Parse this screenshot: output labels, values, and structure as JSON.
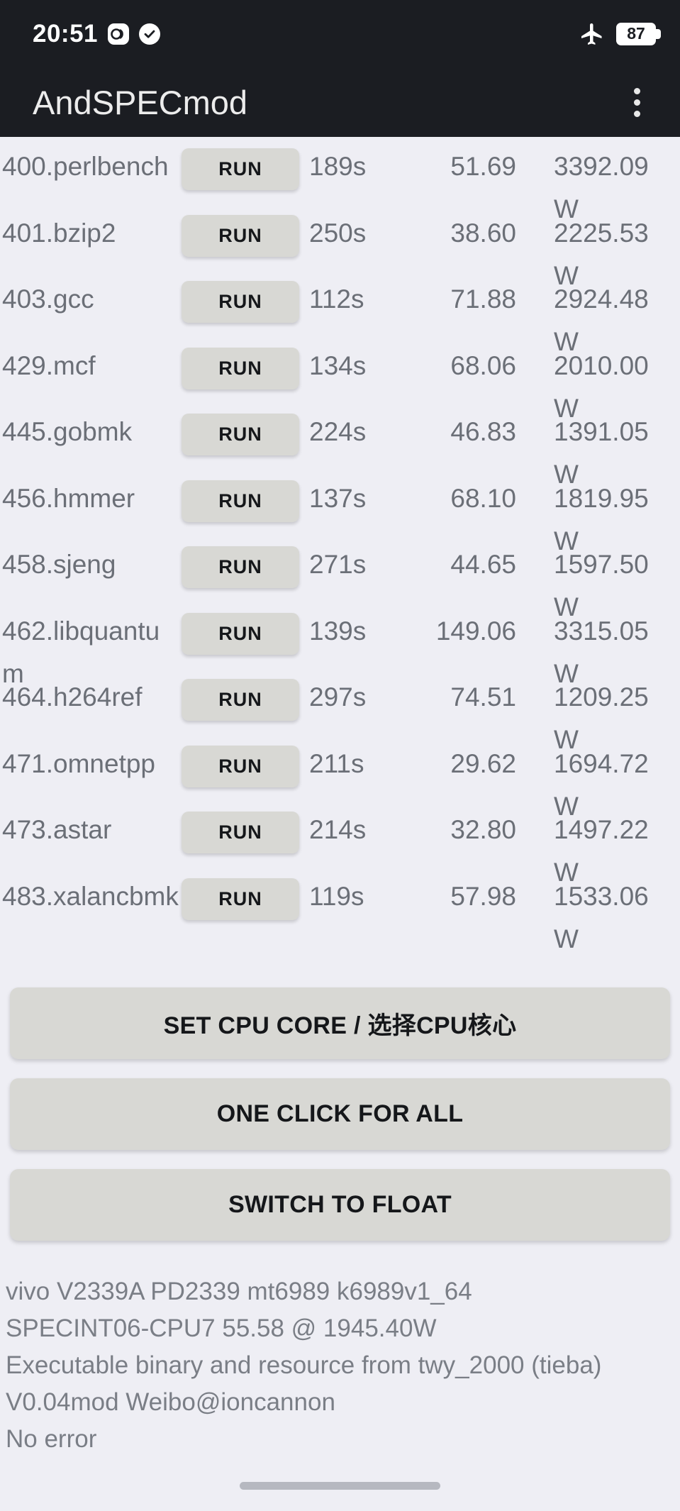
{
  "status_bar": {
    "time": "20:51",
    "icons": [
      "dual-sim-icon",
      "check-circle-icon"
    ],
    "airplane_icon": "airplane-mode-icon",
    "battery_level": "87"
  },
  "app_bar": {
    "title": "AndSPECmod",
    "overflow_icon": "more-vertical-icon"
  },
  "benchmarks": {
    "run_label": "RUN",
    "rows": [
      {
        "name": "400.perlbench",
        "time": "189s",
        "score": "51.69",
        "power": "3392.09 W"
      },
      {
        "name": "401.bzip2",
        "time": "250s",
        "score": "38.60",
        "power": "2225.53 W"
      },
      {
        "name": "403.gcc",
        "time": "112s",
        "score": "71.88",
        "power": "2924.48 W"
      },
      {
        "name": "429.mcf",
        "time": "134s",
        "score": "68.06",
        "power": "2010.00 W"
      },
      {
        "name": "445.gobmk",
        "time": "224s",
        "score": "46.83",
        "power": "1391.05 W"
      },
      {
        "name": "456.hmmer",
        "time": "137s",
        "score": "68.10",
        "power": "1819.95 W"
      },
      {
        "name": "458.sjeng",
        "time": "271s",
        "score": "44.65",
        "power": "1597.50 W"
      },
      {
        "name": "462.libquantum",
        "time": "139s",
        "score": "149.06",
        "power": "3315.05 W"
      },
      {
        "name": "464.h264ref",
        "time": "297s",
        "score": "74.51",
        "power": "1209.25 W"
      },
      {
        "name": "471.omnetpp",
        "time": "211s",
        "score": "29.62",
        "power": "1694.72 W"
      },
      {
        "name": "473.astar",
        "time": "214s",
        "score": "32.80",
        "power": "1497.22 W"
      },
      {
        "name": "483.xalancbmk",
        "time": "119s",
        "score": "57.98",
        "power": "1533.06 W"
      }
    ]
  },
  "actions": {
    "set_cpu_core": "SET CPU CORE / 选择CPU核心",
    "one_click_for_all": "ONE CLICK FOR ALL",
    "switch_to_float": "SWITCH TO FLOAT"
  },
  "info": {
    "device": "vivo V2339A PD2339 mt6989 k6989v1_64",
    "result": "SPECINT06-CPU7  55.58 @ 1945.40W",
    "credit": "Executable binary and resource from twy_2000 (tieba)",
    "version": "V0.04mod  Weibo@ioncannon",
    "error": "No error"
  },
  "colors": {
    "statusbar_bg": "#1b1d22",
    "page_bg": "#eeeef4",
    "button_bg": "#d8d8d4",
    "text_muted": "#6b6f77"
  }
}
